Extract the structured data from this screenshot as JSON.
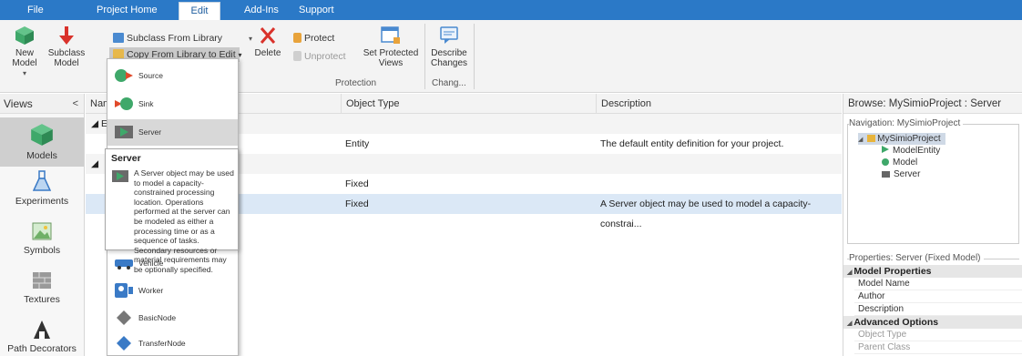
{
  "menubar": {
    "tabs": [
      {
        "label": "File",
        "active": false
      },
      {
        "label": "Project Home",
        "active": false
      },
      {
        "label": "Edit",
        "active": true
      },
      {
        "label": "Add-Ins",
        "active": false
      },
      {
        "label": "Support",
        "active": false
      }
    ]
  },
  "ribbon": {
    "new_model": "New Model",
    "subclass_model_1": "Subclass",
    "subclass_model_2": "Model",
    "subclass_from_library": "Subclass From Library",
    "copy_from_library": "Copy From Library to Edit",
    "delete": "Delete",
    "protect": "Protect",
    "unprotect": "Unprotect",
    "set_protected_views_1": "Set Protected",
    "set_protected_views_2": "Views",
    "describe_changes_1": "Describe",
    "describe_changes_2": "Changes",
    "group_protection": "Protection",
    "group_changes": "Chang..."
  },
  "views": {
    "header": "Views",
    "collapse": "<",
    "items": [
      {
        "label": "Models",
        "icon": "models-icon",
        "active": true
      },
      {
        "label": "Experiments",
        "icon": "experiments-icon",
        "active": false
      },
      {
        "label": "Symbols",
        "icon": "symbols-icon",
        "active": false
      },
      {
        "label": "Textures",
        "icon": "textures-icon",
        "active": false
      },
      {
        "label": "Path Decorators",
        "icon": "path-decorators-icon",
        "active": false
      }
    ]
  },
  "grid": {
    "columns": [
      "Nam",
      "Object Type",
      "Description"
    ],
    "rows": [
      {
        "kind": "group",
        "name": "E",
        "type": "",
        "desc": ""
      },
      {
        "kind": "row",
        "name": "",
        "type": "Entity",
        "desc": "The default entity definition for your project."
      },
      {
        "kind": "group",
        "name": "",
        "type": "",
        "desc": ""
      },
      {
        "kind": "row",
        "name": "",
        "type": "Fixed",
        "desc": ""
      },
      {
        "kind": "sel",
        "name": "",
        "type": "Fixed",
        "desc": "A Server object may be used to model a capacity-constrai..."
      }
    ]
  },
  "dropdown": {
    "items": [
      {
        "label": "Source",
        "icon": "source-icon"
      },
      {
        "label": "Sink",
        "icon": "sink-icon"
      },
      {
        "label": "Server",
        "icon": "server-icon",
        "highlighted": true
      },
      {
        "label": "Vehicle",
        "icon": "vehicle-icon"
      },
      {
        "label": "Worker",
        "icon": "worker-icon"
      },
      {
        "label": "BasicNode",
        "icon": "basicnode-icon"
      },
      {
        "label": "TransferNode",
        "icon": "transfernode-icon"
      }
    ]
  },
  "tooltip": {
    "title": "Server",
    "text": "A Server object may be used to model a capacity-constrained processing location. Operations performed at the server can be modeled as either a processing time or as a sequence of tasks. Secondary resources or material requirements may be optionally specified."
  },
  "browse": {
    "title": "Browse: MySimioProject : Server",
    "navigation_label": "Navigation: MySimioProject",
    "tree": [
      {
        "label": "MySimioProject",
        "icon": "folder-icon",
        "selected": true
      },
      {
        "label": "ModelEntity",
        "icon": "entity-icon"
      },
      {
        "label": "Model",
        "icon": "model-icon"
      },
      {
        "label": "Server",
        "icon": "server-icon"
      }
    ]
  },
  "properties": {
    "label": "Properties: Server (Fixed Model)",
    "categories": [
      {
        "name": "Model Properties",
        "rows": [
          "Model Name",
          "Author",
          "Description"
        ]
      },
      {
        "name": "Advanced Options",
        "rows": [
          "Object Type",
          "Parent Class"
        ]
      }
    ]
  },
  "colors": {
    "menubar": "#2b79c7",
    "accent_green": "#3fa86a",
    "delete_red": "#d9322b",
    "selection": "#dbe8f6"
  }
}
